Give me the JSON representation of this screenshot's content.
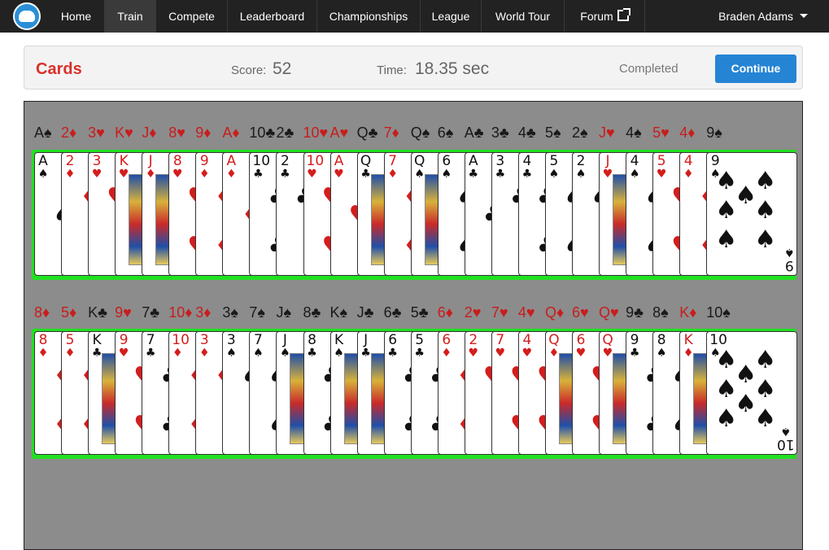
{
  "nav": {
    "items": [
      "Home",
      "Train",
      "Compete",
      "Leaderboard",
      "Championships",
      "League",
      "World Tour",
      "Forum"
    ],
    "active": "Train",
    "user_name": "Braden Adams"
  },
  "header": {
    "title": "Cards",
    "score_label": "Score:",
    "score_value": "52",
    "time_label": "Time:",
    "time_value": "18.35 sec",
    "status": "Completed",
    "continue_label": "Continue"
  },
  "colors": {
    "red_suit": "#c81d1d",
    "highlight": "#22e022",
    "accent": "#2584d4",
    "title": "#d9312b"
  },
  "rows": [
    {
      "labels": [
        "A♠",
        "2♦",
        "3♥",
        "K♥",
        "J♦",
        "8♥",
        "9♦",
        "A♦",
        "10♣",
        "2♣",
        "10♥",
        "A♥",
        "Q♣",
        "7♦",
        "Q♠",
        "6♠",
        "A♣",
        "3♣",
        "4♣",
        "5♠",
        "2♠",
        "J♥",
        "4♠",
        "5♥",
        "4♦",
        "9♠"
      ],
      "cards": [
        {
          "r": "A",
          "s": "♠"
        },
        {
          "r": "2",
          "s": "♦"
        },
        {
          "r": "3",
          "s": "♥"
        },
        {
          "r": "K",
          "s": "♥"
        },
        {
          "r": "J",
          "s": "♦"
        },
        {
          "r": "8",
          "s": "♥"
        },
        {
          "r": "9",
          "s": "♦"
        },
        {
          "r": "A",
          "s": "♦"
        },
        {
          "r": "10",
          "s": "♣"
        },
        {
          "r": "2",
          "s": "♣"
        },
        {
          "r": "10",
          "s": "♥"
        },
        {
          "r": "A",
          "s": "♥"
        },
        {
          "r": "Q",
          "s": "♣"
        },
        {
          "r": "7",
          "s": "♦"
        },
        {
          "r": "Q",
          "s": "♠"
        },
        {
          "r": "6",
          "s": "♠"
        },
        {
          "r": "A",
          "s": "♣"
        },
        {
          "r": "3",
          "s": "♣"
        },
        {
          "r": "4",
          "s": "♣"
        },
        {
          "r": "5",
          "s": "♠"
        },
        {
          "r": "2",
          "s": "♠"
        },
        {
          "r": "J",
          "s": "♥"
        },
        {
          "r": "4",
          "s": "♠"
        },
        {
          "r": "5",
          "s": "♥"
        },
        {
          "r": "4",
          "s": "♦"
        },
        {
          "r": "9",
          "s": "♠"
        }
      ]
    },
    {
      "labels": [
        "8♦",
        "5♦",
        "K♣",
        "9♥",
        "7♣",
        "10♦",
        "3♦",
        "3♠",
        "7♠",
        "J♠",
        "8♣",
        "K♠",
        "J♣",
        "6♣",
        "5♣",
        "6♦",
        "2♥",
        "7♥",
        "4♥",
        "Q♦",
        "6♥",
        "Q♥",
        "9♣",
        "8♠",
        "K♦",
        "10♠"
      ],
      "cards": [
        {
          "r": "8",
          "s": "♦"
        },
        {
          "r": "5",
          "s": "♦"
        },
        {
          "r": "K",
          "s": "♣"
        },
        {
          "r": "9",
          "s": "♥"
        },
        {
          "r": "7",
          "s": "♣"
        },
        {
          "r": "10",
          "s": "♦"
        },
        {
          "r": "3",
          "s": "♦"
        },
        {
          "r": "3",
          "s": "♠"
        },
        {
          "r": "7",
          "s": "♠"
        },
        {
          "r": "J",
          "s": "♠"
        },
        {
          "r": "8",
          "s": "♣"
        },
        {
          "r": "K",
          "s": "♠"
        },
        {
          "r": "J",
          "s": "♣"
        },
        {
          "r": "6",
          "s": "♣"
        },
        {
          "r": "5",
          "s": "♣"
        },
        {
          "r": "6",
          "s": "♦"
        },
        {
          "r": "2",
          "s": "♥"
        },
        {
          "r": "7",
          "s": "♥"
        },
        {
          "r": "4",
          "s": "♥"
        },
        {
          "r": "Q",
          "s": "♦"
        },
        {
          "r": "6",
          "s": "♥"
        },
        {
          "r": "Q",
          "s": "♥"
        },
        {
          "r": "9",
          "s": "♣"
        },
        {
          "r": "8",
          "s": "♠"
        },
        {
          "r": "K",
          "s": "♦"
        },
        {
          "r": "10",
          "s": "♠"
        }
      ]
    }
  ]
}
